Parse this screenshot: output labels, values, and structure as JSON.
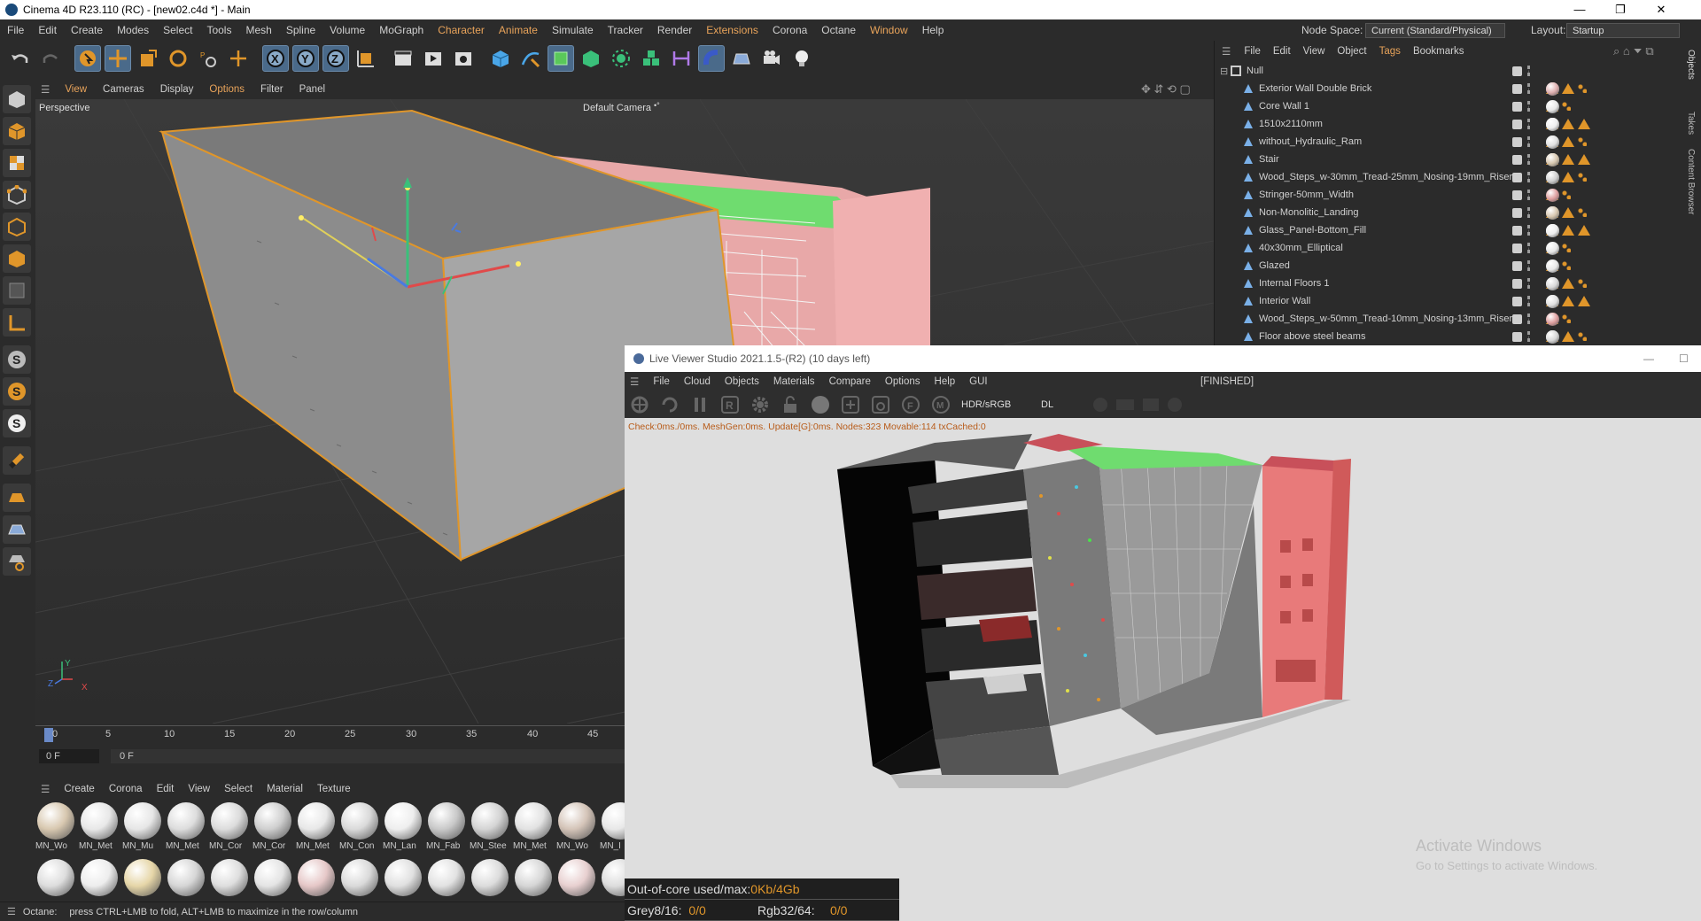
{
  "titlebar": {
    "title": "Cinema 4D R23.110 (RC) - [new02.c4d *] - Main",
    "minimize": "—",
    "restore": "❐",
    "close": "✕"
  },
  "menubar": {
    "items": [
      "File",
      "Edit",
      "Create",
      "Modes",
      "Select",
      "Tools",
      "Mesh",
      "Spline",
      "Volume",
      "MoGraph",
      "Character",
      "Animate",
      "Simulate",
      "Tracker",
      "Render",
      "Extensions",
      "Corona",
      "Octane",
      "Window",
      "Help"
    ],
    "node_space_label": "Node Space:",
    "node_space_value": "Current (Standard/Physical)",
    "layout_label": "Layout:",
    "layout_value": "Startup"
  },
  "viewport_menu": {
    "items": [
      "View",
      "Cameras",
      "Display",
      "Options",
      "Filter",
      "Panel"
    ],
    "view_name": "Perspective",
    "camera": "Default Camera",
    "camera_suffix": "•°"
  },
  "axis_labels": {
    "y": "Y",
    "z": "Z",
    "x": "X"
  },
  "timeline": {
    "ticks": [
      "0",
      "5",
      "10",
      "15",
      "20",
      "25",
      "30",
      "35",
      "40",
      "45"
    ],
    "current_frame": "0 F",
    "end_frame": "0 F"
  },
  "material_menu": {
    "items": [
      "Create",
      "Corona",
      "Edit",
      "View",
      "Select",
      "Material",
      "Texture"
    ]
  },
  "materials_row1": [
    {
      "label": "MN_Wo",
      "color": "#d8c8b0"
    },
    {
      "label": "MN_Met",
      "color": "#e8e8e8"
    },
    {
      "label": "MN_Mu",
      "color": "#e6e6e6"
    },
    {
      "label": "MN_Met",
      "color": "#dddddd"
    },
    {
      "label": "MN_Cor",
      "color": "#dcdcdc"
    },
    {
      "label": "MN_Cor",
      "color": "#cfcfcf"
    },
    {
      "label": "MN_Met",
      "color": "#e8e8e8"
    },
    {
      "label": "MN_Con",
      "color": "#dadada"
    },
    {
      "label": "MN_Lan",
      "color": "#eeeeee"
    },
    {
      "label": "MN_Fab",
      "color": "#c9c9c9"
    },
    {
      "label": "MN_Stee",
      "color": "#d4d4d4"
    },
    {
      "label": "MN_Met",
      "color": "#e2e2e2"
    },
    {
      "label": "MN_Wo",
      "color": "#d4c4b8"
    },
    {
      "label": "MN_I",
      "color": "#e8e8e8"
    }
  ],
  "materials_row2": [
    {
      "color": "#dddddd"
    },
    {
      "color": "#ededed"
    },
    {
      "color": "#e6d6a8"
    },
    {
      "color": "#d6d6d6"
    },
    {
      "color": "#dedede"
    },
    {
      "color": "#e4e4e4"
    },
    {
      "color": "#e6c8c8"
    },
    {
      "color": "#dadada"
    },
    {
      "color": "#e0e0e0"
    },
    {
      "color": "#e2e2e2"
    },
    {
      "color": "#dcdcdc"
    },
    {
      "color": "#d6d6d6"
    },
    {
      "color": "#e8d0d0"
    },
    {
      "color": "#dddddd"
    }
  ],
  "statusbar": {
    "prefix": "Octane:",
    "message": "press CTRL+LMB to fold, ALT+LMB to maximize in the row/column"
  },
  "object_manager": {
    "menu": [
      "File",
      "Edit",
      "View",
      "Object",
      "Tags",
      "Bookmarks"
    ],
    "root": "Null",
    "objects": [
      {
        "name": "Exterior Wall Double Brick",
        "tags": [
          "mat:#e8e8e8",
          "mat:#e0b0b0",
          "tri",
          "tri",
          "chk",
          "dot"
        ]
      },
      {
        "name": "Core Wall 1",
        "tags": [
          "mat:#e8e8e8",
          "tri",
          "chk",
          "dot"
        ]
      },
      {
        "name": "1510x2110mm",
        "tags": [
          "mat:#e8e8e8",
          "mat:#d8c8b0",
          "mat:#eeeeee",
          "tri",
          "tri",
          "tri",
          "chk"
        ]
      },
      {
        "name": "without_Hydraulic_Ram",
        "tags": [
          "mat:#e8e8e8",
          "mat:#e0e0e0",
          "tri",
          "tri",
          "chk",
          "dot"
        ]
      },
      {
        "name": "Stair",
        "tags": [
          "mat:#e0b0b0",
          "mat:#e8e8e8",
          "mat:#d8c8b0",
          "tri",
          "tri",
          "tri",
          "chk"
        ]
      },
      {
        "name": "Wood_Steps_w-30mm_Tread-25mm_Nosing-19mm_Riser",
        "tags": [
          "mat:#e8e8e8",
          "mat:#d0d0d0",
          "tri",
          "tri",
          "chk",
          "dot"
        ]
      },
      {
        "name": "Stringer-50mm_Width",
        "tags": [
          "mat:#e0a0a0",
          "tri",
          "chk",
          "dot"
        ]
      },
      {
        "name": "Non-Monolitic_Landing",
        "tags": [
          "mat:#e8e8e8",
          "mat:#d8c8b0",
          "tri",
          "tri",
          "chk",
          "dot"
        ]
      },
      {
        "name": "Glass_Panel-Bottom_Fill",
        "tags": [
          "mat:#e8e8e8",
          "mat:#e0e0e0",
          "mat:#eeeeee",
          "tri",
          "tri",
          "tri",
          "chk"
        ]
      },
      {
        "name": "40x30mm_Elliptical",
        "tags": [
          "mat:#e8e8e8",
          "tri",
          "chk",
          "dot"
        ]
      },
      {
        "name": "Glazed",
        "tags": [
          "mat:#e8e8e8",
          "tri",
          "chk",
          "dot"
        ]
      },
      {
        "name": "Internal Floors 1",
        "tags": [
          "mat:#e8e8e8",
          "mat:#d8d8d8",
          "tri",
          "tri",
          "chk",
          "dot"
        ]
      },
      {
        "name": "Interior Wall",
        "tags": [
          "mat:#e8e8e8",
          "mat:#e0e0e0",
          "tri",
          "tri",
          "tri",
          "chk"
        ]
      },
      {
        "name": "Wood_Steps_w-50mm_Tread-10mm_Nosing-13mm_Riser",
        "tags": [
          "mat:#e0a0a0",
          "tri",
          "chk",
          "dot"
        ]
      },
      {
        "name": "Floor above steel beams",
        "tags": [
          "mat:#e8e8e8",
          "mat:#d8d8d8",
          "tri",
          "tri",
          "chk",
          "dot"
        ]
      }
    ]
  },
  "side_tabs": [
    "Objects",
    "Takes",
    "Content Browser"
  ],
  "live_viewer": {
    "title": "Live Viewer Studio 2021.1.5-(R2) (10 days left)",
    "menu": [
      "File",
      "Cloud",
      "Objects",
      "Materials",
      "Compare",
      "Options",
      "Help",
      "GUI"
    ],
    "status": "[FINISHED]",
    "color_space": "HDR/sRGB",
    "kernel": "DL",
    "stats": "Check:0ms./0ms. MeshGen:0ms. Update[G]:0ms. Nodes:323 Movable:114 txCached:0",
    "ooc_label": "Out-of-core used/max:",
    "ooc_value": "0Kb/4Gb",
    "grey_label": "Grey8/16:",
    "grey_value": "0/0",
    "rgb_label": "Rgb32/64:",
    "rgb_value": "0/0",
    "minimize": "—",
    "maximize": "☐"
  },
  "watermark": {
    "title": "Activate Windows",
    "subtitle": "Go to Settings to activate Windows."
  },
  "colors": {
    "accent": "#e8a35a",
    "selection_orange": "#e0962a",
    "roof_green": "#6fdc6f",
    "wall_pink": "#e87a7a"
  }
}
